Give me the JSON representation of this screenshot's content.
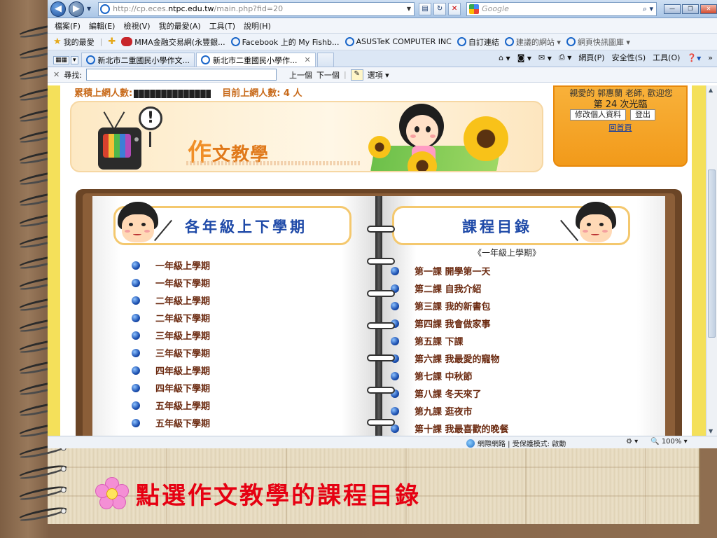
{
  "browser": {
    "url_prefix": "http://cp.eces.",
    "url_host": "ntpc.edu.tw",
    "url_path": "/main.php?fid=20",
    "search_placeholder": "Google",
    "menu": [
      "檔案(F)",
      "編輯(E)",
      "檢視(V)",
      "我的最愛(A)",
      "工具(T)",
      "說明(H)"
    ],
    "favorites_label": "我的最愛",
    "favorites": [
      {
        "label": "MMA金融交易網(永豐銀...",
        "icon": "mma-icon"
      },
      {
        "label": "Facebook 上的 My Fishb...",
        "icon": "ie-icon"
      },
      {
        "label": "ASUSTeK COMPUTER INC",
        "icon": "ie-icon"
      },
      {
        "label": "自訂連結",
        "icon": "ie-icon"
      },
      {
        "label": "建議的網站 ▾",
        "icon": "ie-icon",
        "faded": true
      },
      {
        "label": "網頁快訊圖庫 ▾",
        "icon": "ie-icon",
        "faded": true
      }
    ],
    "tabs": [
      {
        "label": "新北市二重國民小學作文...",
        "active": false
      },
      {
        "label": "新北市二重國民小學作...",
        "active": true
      }
    ],
    "commands": [
      "網頁(P)",
      "安全性(S)",
      "工具(O)"
    ],
    "find_label": "尋找:",
    "find_prev": "上一個",
    "find_next": "下一個",
    "find_options": "選項",
    "status_zone": "網際網路 | 受保護模式: 啟動",
    "zoom": "100%"
  },
  "page": {
    "counter_label": "累積上網人數:",
    "online_label": "目前上網人數: 4 人",
    "banner_title_big": "作",
    "banner_title_rest": "文教學",
    "login_line1": "親愛的 郭惠蘭 老師, 歡迎您",
    "login_line2": "第 24 次光臨",
    "login_edit_button": "修改個人資料",
    "login_logout_button": "登出",
    "home_link": "回首頁",
    "left_header": "各年級上下學期",
    "right_header": "課程目錄",
    "semester_label": "《一年級上學期》",
    "semesters": [
      "一年級上學期",
      "一年級下學期",
      "二年級上學期",
      "二年級下學期",
      "三年級上學期",
      "三年級下學期",
      "四年級上學期",
      "四年級下學期",
      "五年級上學期",
      "五年級下學期"
    ],
    "lessons": [
      "第一課 開學第一天",
      "第二課 自我介紹",
      "第三課 我的新書包",
      "第四課 我會做家事",
      "第五課 下課",
      "第六課 我最愛的寵物",
      "第七課 中秋節",
      "第八課 冬天來了",
      "第九課 逛夜市",
      "第十課 我最喜歡的晚餐"
    ]
  },
  "slide": {
    "caption": "點選作文教學的課程目錄"
  },
  "colors": {
    "caption": "#e60012",
    "header_text": "#1f4aa8",
    "list_text": "#6b2a10",
    "login_bg": "#f29a1a"
  }
}
